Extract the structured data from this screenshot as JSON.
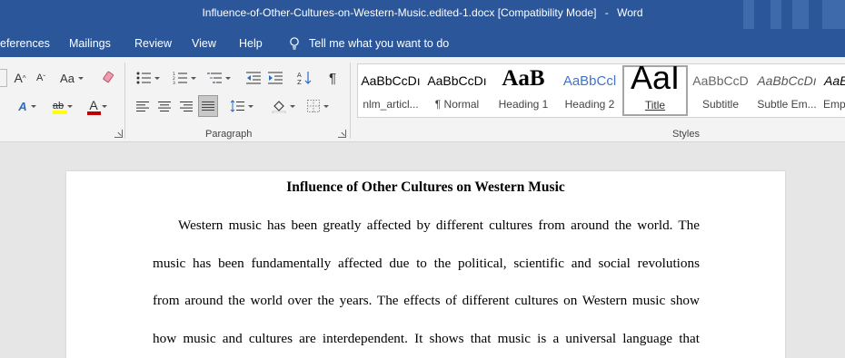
{
  "window": {
    "doc_name": "Influence-of-Other-Cultures-on-Western-Music.edited-1.docx [Compatibility Mode]",
    "separator": "-",
    "app_name": "Word"
  },
  "tabs": [
    "eferences",
    "Mailings",
    "Review",
    "View",
    "Help"
  ],
  "tell_me": "Tell me what you want to do",
  "ribbon": {
    "font_group": {
      "grow_font": "A",
      "shrink_font": "A",
      "change_case": "Aa",
      "text_effects": "A",
      "highlight": "ab",
      "font_color": "A",
      "font_color_hex": "#c00000",
      "highlight_hex": "#ffff00"
    },
    "paragraph_group": {
      "label": "Paragraph",
      "sort": "A↓Z",
      "pilcrow": "¶"
    },
    "styles_group": {
      "label": "Styles",
      "items": [
        {
          "sample": "AaBbCcDı",
          "name": "nlm_articl..."
        },
        {
          "sample": "AaBbCcDı",
          "name": "¶ Normal"
        },
        {
          "sample": "AaB",
          "name": "Heading 1"
        },
        {
          "sample": "AaBbCcl",
          "name": "Heading 2"
        },
        {
          "sample": "AaI",
          "name": "Title"
        },
        {
          "sample": "AaBbCcD",
          "name": "Subtitle"
        },
        {
          "sample": "AaBbCcDı",
          "name": "Subtle Em..."
        },
        {
          "sample": "AaBl",
          "name": "Emp"
        }
      ]
    }
  },
  "document": {
    "title": "Influence of Other Cultures on Western Music",
    "lines": [
      "Western music has been greatly affected by different cultures from around the world. The",
      "music has been fundamentally affected due to the political, scientific and social revolutions",
      "from around the world over the years. The effects of different cultures on Western music show",
      "how music and cultures are interdependent. It shows that music is a universal language that"
    ]
  },
  "colors": {
    "title_bar": "#2b579a",
    "ribbon": "#f3f3f3",
    "canvas": "#e6e6e6"
  }
}
